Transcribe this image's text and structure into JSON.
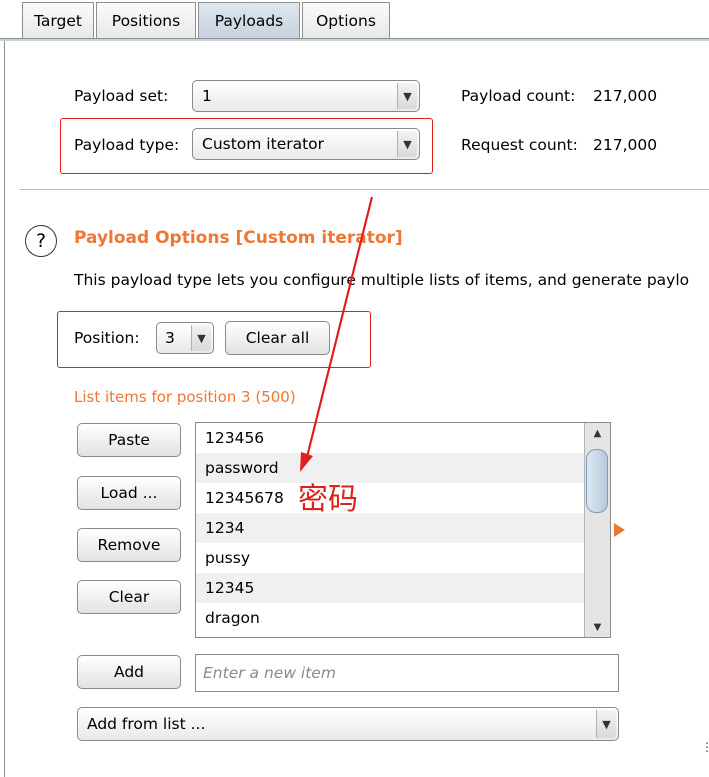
{
  "tabs": [
    {
      "label": "Target"
    },
    {
      "label": "Positions"
    },
    {
      "label": "Payloads"
    },
    {
      "label": "Options"
    }
  ],
  "payload_sets": {
    "set_label": "Payload set:",
    "set_value": "1",
    "type_label": "Payload type:",
    "type_value": "Custom iterator",
    "payload_count_label": "Payload count:",
    "payload_count_value": "217,000",
    "request_count_label": "Request count:",
    "request_count_value": "217,000"
  },
  "options": {
    "help_symbol": "?",
    "heading": "Payload Options [Custom iterator]",
    "description": "This payload type lets you configure multiple lists of items, and generate paylo",
    "position_label": "Position:",
    "position_value": "3",
    "clear_all_label": "Clear all",
    "list_header": "List items for position 3 (500)",
    "buttons": {
      "paste": "Paste",
      "load": "Load ...",
      "remove": "Remove",
      "clear": "Clear",
      "add": "Add"
    },
    "items": [
      "123456",
      "password",
      "12345678",
      "1234",
      "pussy",
      "12345",
      "dragon"
    ],
    "new_item_placeholder": "Enter a new item",
    "add_from_list": "Add from list ..."
  },
  "annotation": {
    "text": "密码",
    "color": "#e0201a"
  },
  "colors": {
    "accent": "#ee7733",
    "highlight_box": "#e0201a",
    "active_tab": "#c6d2de"
  }
}
